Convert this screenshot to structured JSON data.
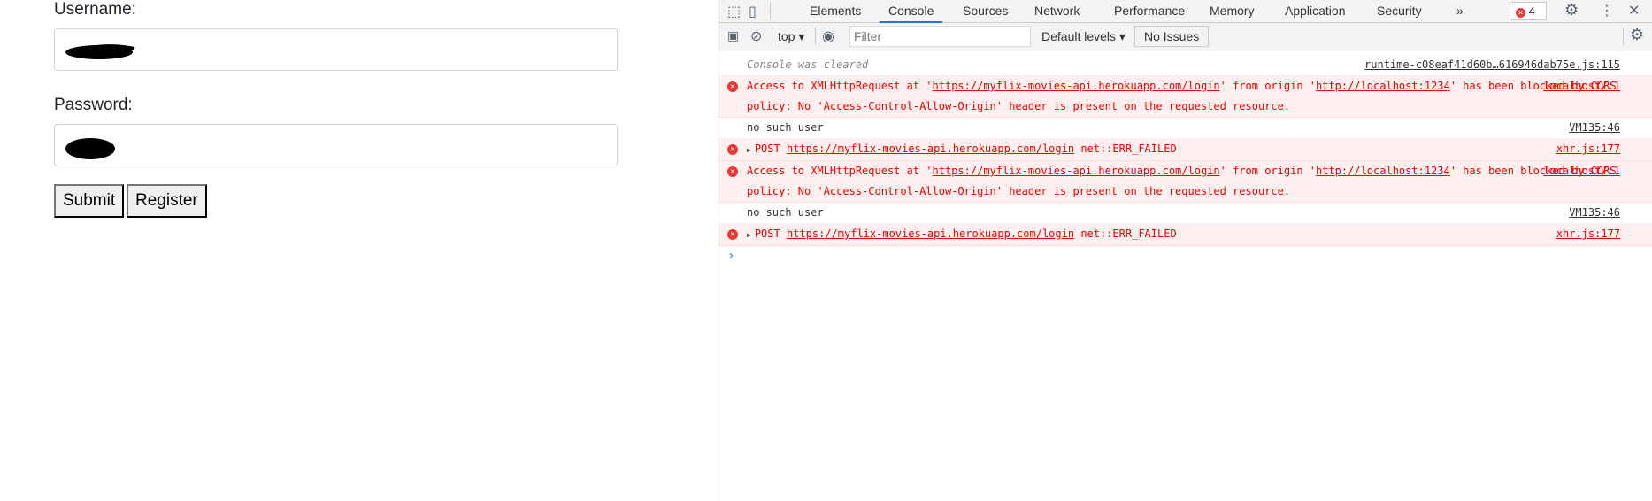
{
  "form": {
    "username_label": "Username:",
    "password_label": "Password:",
    "submit": "Submit",
    "register": "Register"
  },
  "devtools": {
    "tabs": [
      "Elements",
      "Console",
      "Sources",
      "Network",
      "Performance",
      "Memory",
      "Application",
      "Security"
    ],
    "active_tab": "Console",
    "more": "»",
    "error_count": "4",
    "toolbar": {
      "context": "top",
      "filter_placeholder": "Filter",
      "levels": "Default levels",
      "issues": "No Issues"
    },
    "accent": "#1a73e8",
    "error_color": "#e00000",
    "messages": [
      {
        "type": "info",
        "text": "Console was cleared",
        "source": "runtime-c08eaf41d60b…616946dab75e.js:115"
      },
      {
        "type": "error",
        "pre": "Access to XMLHttpRequest at '",
        "url": "https://myflix-movies-api.herokuapp.com/login",
        "mid": "' from origin '",
        "origin": "http://localhost:1234",
        "post": "' has been blocked by CORS policy: No 'Access-Control-Allow-Origin' header is present on the requested resource.",
        "source": "localhost/:1"
      },
      {
        "type": "log",
        "text": "no such user",
        "source": "VM135:46"
      },
      {
        "type": "error",
        "method": "POST",
        "url": "https://myflix-movies-api.herokuapp.com/login",
        "status": "net::ERR_FAILED",
        "source": "xhr.js:177"
      },
      {
        "type": "error",
        "pre": "Access to XMLHttpRequest at '",
        "url": "https://myflix-movies-api.herokuapp.com/login",
        "mid": "' from origin '",
        "origin": "http://localhost:1234",
        "post": "' has been blocked by CORS policy: No 'Access-Control-Allow-Origin' header is present on the requested resource.",
        "source": "localhost/:1"
      },
      {
        "type": "log",
        "text": "no such user",
        "source": "VM135:46"
      },
      {
        "type": "error",
        "method": "POST",
        "url": "https://myflix-movies-api.herokuapp.com/login",
        "status": "net::ERR_FAILED",
        "source": "xhr.js:177"
      }
    ]
  }
}
